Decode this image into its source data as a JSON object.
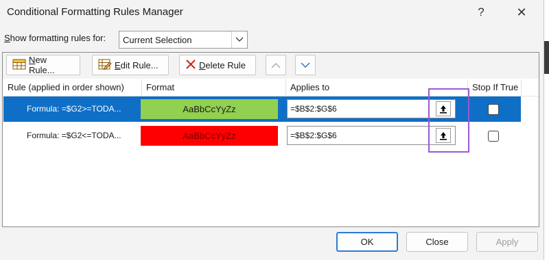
{
  "window": {
    "title": "Conditional Formatting Rules Manager",
    "help": "?",
    "close": "✕"
  },
  "show_rules": {
    "label_accel": "S",
    "label_rest": "how formatting rules for:",
    "selected": "Current Selection"
  },
  "toolbar": {
    "new_rule_accel": "N",
    "new_rule_rest": "ew Rule...",
    "edit_rule_accel": "E",
    "edit_rule_rest": "dit Rule...",
    "delete_rule_accel": "D",
    "delete_rule_rest": "elete Rule"
  },
  "columns": {
    "rule": "Rule (applied in order shown)",
    "format": "Format",
    "applies": "Applies to",
    "stop": "Stop If True"
  },
  "rules": [
    {
      "formula": "Formula: =$G2>=TODA...",
      "preview": "AaBbCcYyZz",
      "applies_to": "=$B$2:$G$6",
      "preview_bg": "#92d050",
      "preview_fg": "#1a1a1a",
      "selected": true,
      "stop_if_true": false
    },
    {
      "formula": "Formula: =$G2<=TODA...",
      "preview": "AaBbCcYyZz",
      "applies_to": "=$B$2:$G$6",
      "preview_bg": "#ff0000",
      "preview_fg": "#7a0000",
      "selected": false,
      "stop_if_true": false
    }
  ],
  "buttons": {
    "ok": "OK",
    "close": "Close",
    "apply": "Apply"
  },
  "colors": {
    "selection": "#0f6fc6",
    "highlight": "#9b59d0"
  }
}
